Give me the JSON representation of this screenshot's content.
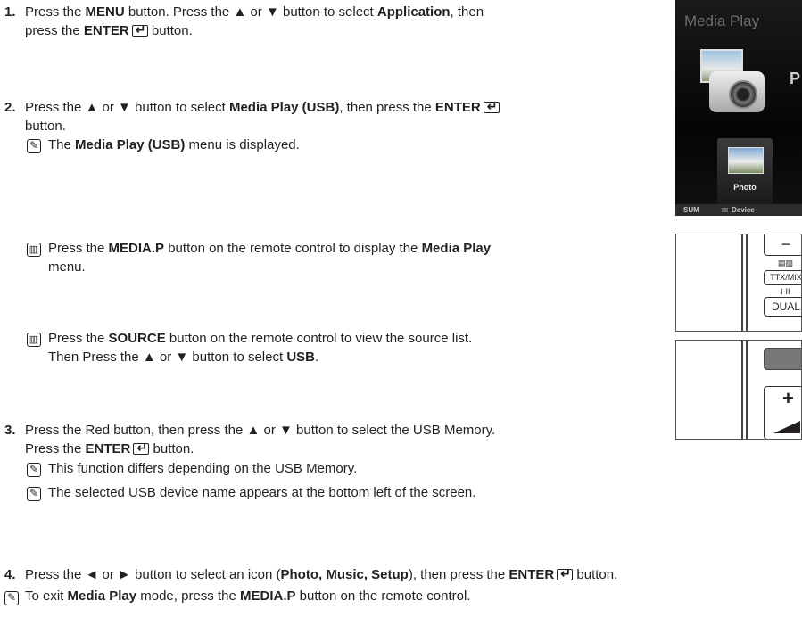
{
  "step1": {
    "num": "1.",
    "l1_a": "Press the ",
    "l1_b": "MENU",
    "l1_c": " button. Press the ▲ or ▼ button to select ",
    "l1_d": "Application",
    "l1_e": ", then",
    "l2_a": "press the ",
    "l2_b": "ENTER",
    "l2_c": " button."
  },
  "step2": {
    "num": "2.",
    "l1_a": "Press the ▲ or ▼ button to select ",
    "l1_b": "Media Play (USB)",
    "l1_c": ", then press the ",
    "l1_d": "ENTER",
    "l2": "button.",
    "note1_a": "The ",
    "note1_b": "Media Play (USB)",
    "note1_c": " menu is displayed.",
    "tip1_l1_a": "Press the ",
    "tip1_l1_b": "MEDIA.P",
    "tip1_l1_c": " button on the remote control to display the ",
    "tip1_l1_d": "Media Play",
    "tip1_l2": "menu.",
    "tip2_l1_a": "Press the ",
    "tip2_l1_b": "SOURCE",
    "tip2_l1_c": " button on the remote control to view the source list.",
    "tip2_l2_a": "Then Press the ▲ or ▼ button to select ",
    "tip2_l2_b": "USB",
    "tip2_l2_c": "."
  },
  "step3": {
    "num": "3.",
    "l1": "Press the Red button, then press the ▲ or ▼ button to select the USB Memory.",
    "l2_a": "Press the ",
    "l2_b": "ENTER",
    "l2_c": " button.",
    "note1": "This function differs depending on the USB Memory.",
    "note2": "The selected USB device name appears at the bottom left of the screen."
  },
  "step4": {
    "num": "4.",
    "l1_a": "Press the ◄ or ► button to select an icon (",
    "l1_b": "Photo, Music, Setup",
    "l1_c": "), then press the ",
    "l1_d": "ENTER",
    "l1_e": " button."
  },
  "final_note": {
    "a": "To exit ",
    "b": "Media Play",
    "c": " mode, press the ",
    "d": "MEDIA.P",
    "e": " button on the remote control."
  },
  "screen": {
    "title": "Media Play",
    "side_letter": "P",
    "tile_label": "Photo",
    "bar_sum": "SUM",
    "bar_device": "Device"
  },
  "remote1": {
    "minus": "−",
    "ttx": "TTX/MIX",
    "dual_top": "I-II",
    "dual": "DUAL"
  },
  "remote2": {
    "plus": "+"
  }
}
